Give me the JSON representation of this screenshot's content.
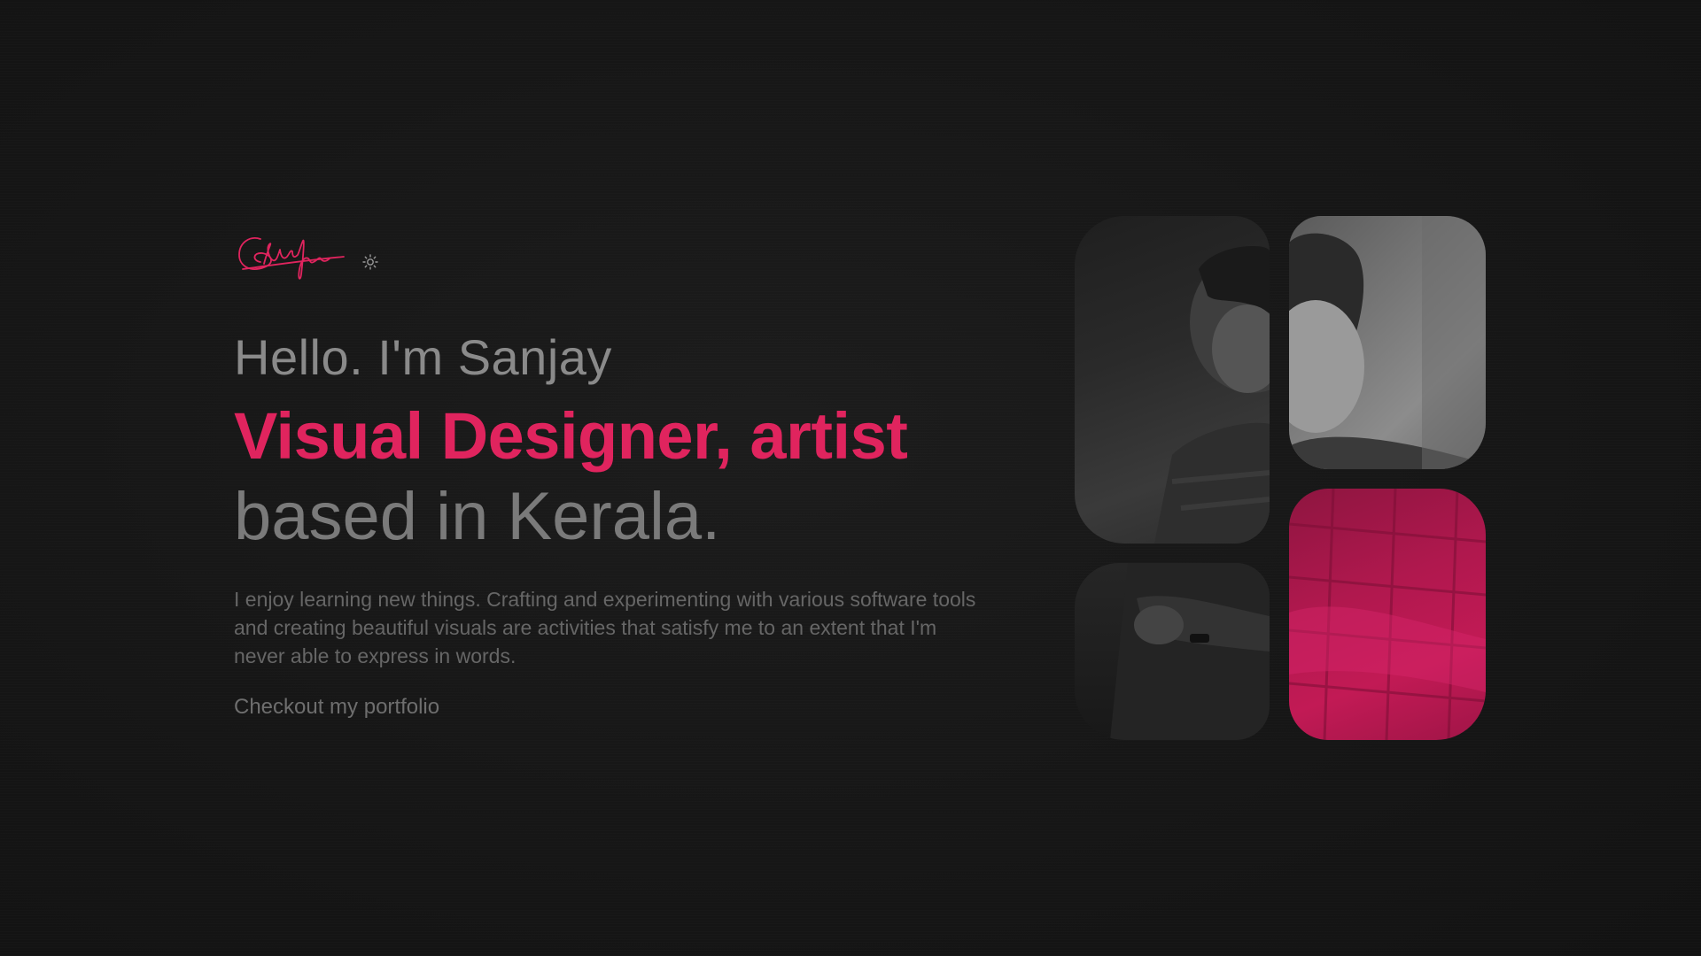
{
  "brand": {
    "signature_text": "Sanjay",
    "theme_toggle_icon": "sun-icon"
  },
  "hero": {
    "greeting": "Hello. I'm Sanjay",
    "role": "Visual Designer, artist",
    "location": "based in Kerala.",
    "bio": "I enjoy learning new things. Crafting and experimenting with various software tools and creating beautiful visuals are activities that satisfy me to an extent that I'm never able to express in words.",
    "cta_label": "Checkout my portfolio"
  },
  "colors": {
    "background": "#161616",
    "accent": "#e0245e",
    "heading_gray": "#8a8a8a",
    "body_gray": "#666666"
  },
  "collage": {
    "tiles": [
      "portrait-left",
      "portrait-right",
      "arms-crossed",
      "shirt-accent"
    ]
  }
}
